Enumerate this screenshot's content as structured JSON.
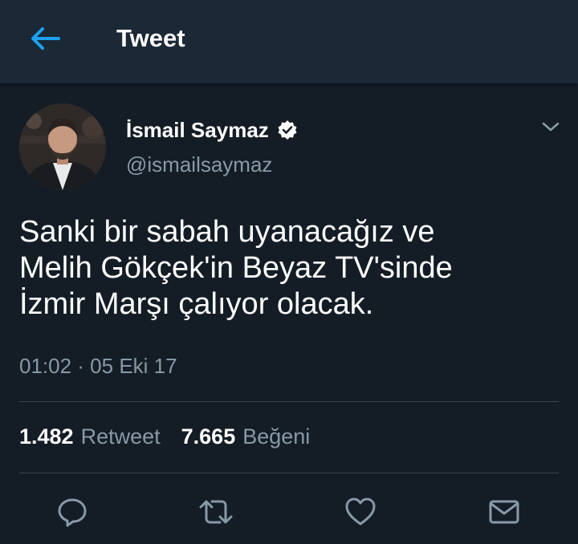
{
  "header": {
    "title": "Tweet",
    "back_icon": "arrow-left-icon",
    "accent_color": "#1da1f2"
  },
  "tweet": {
    "author": {
      "display_name": "İsmail Saymaz",
      "handle": "@ismailsaymaz",
      "verified": true
    },
    "text_lines": [
      "Sanki bir sabah uyanacağız ve",
      "Melih Gökçek'in Beyaz TV'sinde",
      "İzmir Marşı çalıyor olacak."
    ],
    "timestamp": "01:02 · 05 Eki 17"
  },
  "stats": {
    "retweets": {
      "count": "1.482",
      "label": "Retweet"
    },
    "likes": {
      "count": "7.665",
      "label": "Beğeni"
    }
  },
  "actions": [
    {
      "name": "reply",
      "icon": "reply-icon"
    },
    {
      "name": "retweet",
      "icon": "retweet-icon"
    },
    {
      "name": "like",
      "icon": "heart-icon"
    },
    {
      "name": "share",
      "icon": "mail-icon"
    }
  ],
  "colors": {
    "background": "#141d26",
    "header_background": "#1b2836",
    "secondary_text": "#8899a6",
    "divider": "#38444d"
  }
}
